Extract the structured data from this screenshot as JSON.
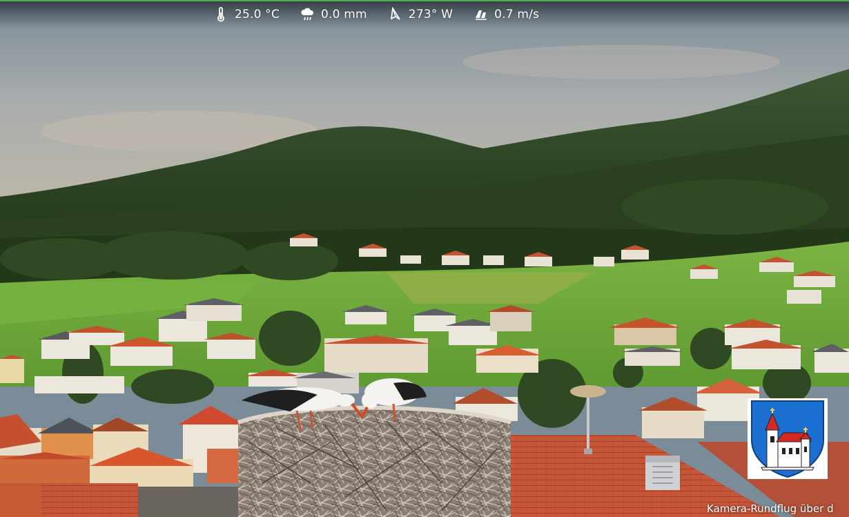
{
  "weather": {
    "temperature": "25.0 °C",
    "precipitation": "0.0 mm",
    "wind_direction": "273° W",
    "wind_speed": "0.7 m/s",
    "icons": [
      "thermometer-icon",
      "rain-cloud-icon",
      "wind-direction-icon",
      "wind-speed-icon"
    ]
  },
  "caption": {
    "text": "Kamera-Rundflug über d"
  },
  "colors": {
    "sky_top": "#7f8e99",
    "sky_bottom": "#b7b6b0",
    "forest": "#2e4424",
    "meadow": "#6fae3a",
    "roof": "#c45a34",
    "crest_blue": "#1a6fd0",
    "crest_red": "#d42a22"
  }
}
